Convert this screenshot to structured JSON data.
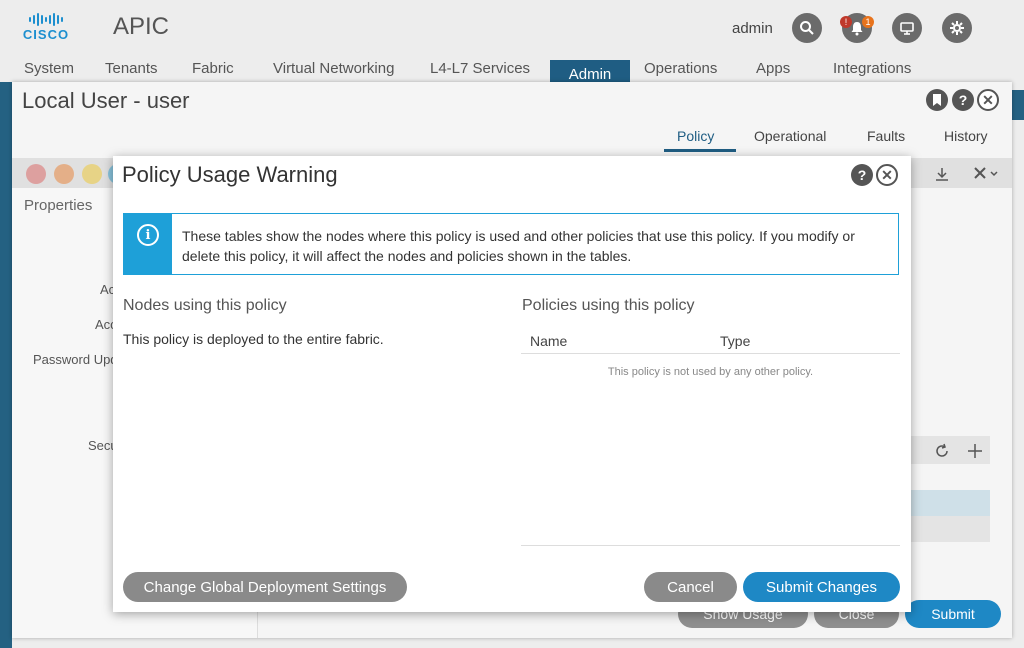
{
  "app": {
    "logo_text": "CISCO",
    "title": "APIC",
    "user": "admin",
    "alert_badges": [
      "!",
      "1"
    ]
  },
  "nav": {
    "items": [
      "System",
      "Tenants",
      "Fabric",
      "Virtual Networking",
      "L4-L7 Services",
      "Admin",
      "Operations",
      "Apps",
      "Integrations"
    ],
    "active": "Admin"
  },
  "window": {
    "title": "Local User - user",
    "tabs": [
      "Policy",
      "Operational",
      "Faults",
      "History"
    ],
    "active_tab": "Policy",
    "properties_label": "Properties",
    "field_labels": [
      "Ac",
      "Acc",
      "Password Upd",
      "Secu"
    ],
    "buttons": {
      "show_usage": "Show Usage",
      "close": "Close",
      "submit": "Submit"
    }
  },
  "modal": {
    "title": "Policy Usage Warning",
    "info_text": "These tables show the nodes where this policy is used and other policies that use this policy. If you modify or delete this policy, it will affect the nodes and policies shown in the tables.",
    "nodes_heading": "Nodes using this policy",
    "nodes_text": "This policy is deployed to the entire fabric.",
    "policies_heading": "Policies using this policy",
    "columns": [
      "Name",
      "Type"
    ],
    "empty_text": "This policy is not used by any other policy.",
    "buttons": {
      "change_global": "Change Global Deployment Settings",
      "cancel": "Cancel",
      "submit_changes": "Submit Changes"
    }
  },
  "colors": {
    "brand_blue": "#1d8fcf",
    "nav_active": "#1f5d83",
    "primary_button": "#1e88c5",
    "info_accent": "#1ea0d8"
  }
}
